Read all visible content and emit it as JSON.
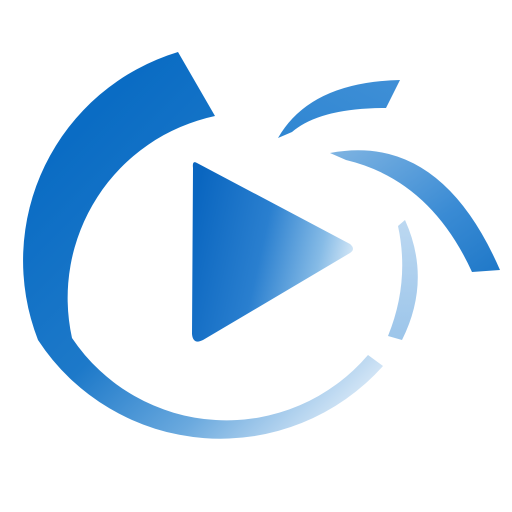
{
  "colors": {
    "background": "#ffffff",
    "primary_blue": "#0a6cc4",
    "mid_blue": "#3f8fd6",
    "light_blue": "#a9cdee",
    "pale_blue": "#d3e6f6"
  },
  "icons": {
    "logo": "play-logo-icon",
    "play": "play-triangle-icon"
  }
}
